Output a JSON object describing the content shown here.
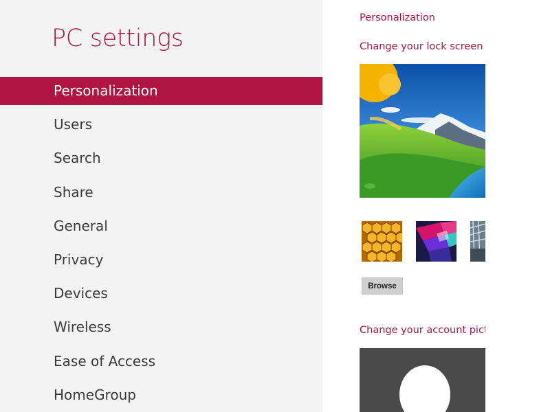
{
  "theme": {
    "accent": "#ae1540",
    "left_bg": "#f3f3f3"
  },
  "left": {
    "title": "PC settings",
    "nav": [
      {
        "label": "Personalization",
        "selected": true
      },
      {
        "label": "Users",
        "selected": false
      },
      {
        "label": "Search",
        "selected": false
      },
      {
        "label": "Share",
        "selected": false
      },
      {
        "label": "General",
        "selected": false
      },
      {
        "label": "Privacy",
        "selected": false
      },
      {
        "label": "Devices",
        "selected": false
      },
      {
        "label": "Wireless",
        "selected": false
      },
      {
        "label": "Ease of Access",
        "selected": false
      },
      {
        "label": "HomeGroup",
        "selected": false
      }
    ]
  },
  "right": {
    "section_title": "Personalization",
    "lock_screen": {
      "heading": "Change your lock screen background",
      "browse_label": "Browse"
    },
    "account_picture": {
      "heading": "Change your account picture"
    }
  }
}
